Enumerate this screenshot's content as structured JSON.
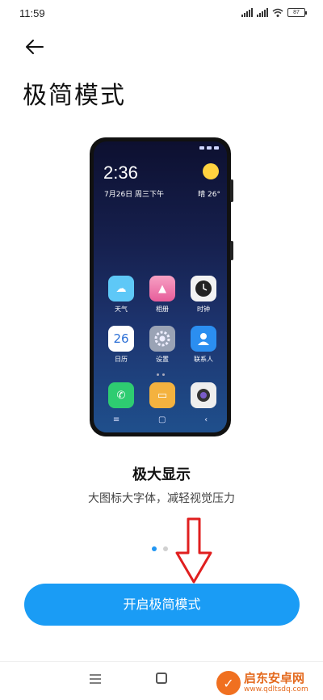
{
  "status_bar": {
    "time": "11:59",
    "battery": "87",
    "icons": [
      "signal-icon",
      "signal-icon",
      "wifi-icon",
      "battery-icon"
    ]
  },
  "header": {
    "back_icon": "arrow-left-icon",
    "title": "极简模式"
  },
  "illustration": {
    "time": "2:36",
    "date": "7月26日 周三下午",
    "weather": "晴 26°",
    "apps": [
      {
        "label": "天气",
        "icon": "weather-icon",
        "color": "#5ec8f7"
      },
      {
        "label": "相册",
        "icon": "gallery-icon",
        "color": "#f58bb5"
      },
      {
        "label": "时钟",
        "icon": "clock-icon",
        "color": "#f2f2f2"
      },
      {
        "label": "日历",
        "icon": "calendar-icon",
        "color": "#ffffff",
        "text": "26"
      },
      {
        "label": "设置",
        "icon": "settings-icon",
        "color": "#9aa3b5"
      },
      {
        "label": "联系人",
        "icon": "contacts-icon",
        "color": "#2b8ef0"
      },
      {
        "label": "",
        "icon": "phone-icon",
        "color": "#2ecc71"
      },
      {
        "label": "",
        "icon": "notes-icon",
        "color": "#f4b23f"
      },
      {
        "label": "",
        "icon": "camera-icon",
        "color": "#eeeeee"
      }
    ],
    "nav_icons": [
      "menu-icon",
      "home-icon",
      "back-icon"
    ]
  },
  "feature": {
    "title": "极大显示",
    "subtitle": "大图标大字体，减轻视觉压力"
  },
  "pagination": {
    "count": 2,
    "active": 0
  },
  "primary_button": {
    "label": "开启极简模式"
  },
  "nav_bar": {
    "icons": [
      "menu-icon",
      "home-icon"
    ]
  },
  "watermark": {
    "name": "启东安卓网",
    "url": "www.qdltsdq.com"
  },
  "colors": {
    "accent": "#1a9cf5",
    "annotation_arrow": "#e01f1f",
    "watermark": "#e46a1e"
  }
}
